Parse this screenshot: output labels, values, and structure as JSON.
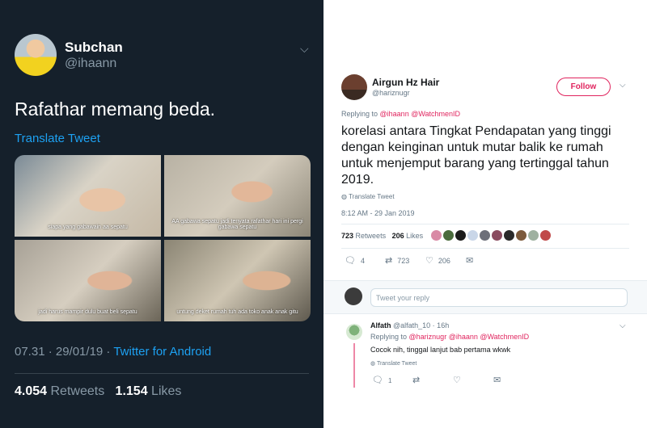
{
  "left_tweet": {
    "display_name": "Subchan",
    "handle": "@ihaann",
    "menu_icon": "chevron-down-icon",
    "text": "Rafathar memang beda.",
    "translate_label": "Translate Tweet",
    "media_captions": [
      "siapa yang gabawain aa sepatu",
      "AA gabawa sepatu jadi tenyata rafathar hari ini pergi gabawa sepatu",
      "jadi harus mampir dulu buat beli sepatu",
      "untung deket rumah tuh ada toko anak anak gitu"
    ],
    "timestamp": "07.31 · 29/01/19 · ",
    "via": "Twitter for Android",
    "retweets_count": "4.054",
    "retweets_label": "Retweets",
    "likes_count": "1.154",
    "likes_label": "Likes",
    "colors": {
      "background": "#15202b",
      "link": "#1da1f2",
      "muted": "#8899a6"
    }
  },
  "right_tweet": {
    "display_name": "Airgun Hz Hair",
    "handle": "@hariznugr",
    "follow_label": "Follow",
    "menu_icon": "chevron-down-icon",
    "replying_prefix": "Replying to ",
    "replying_mentions": "@ihaann @WatchmenID",
    "text": "korelasi antara Tingkat Pendapatan yang tinggi dengan keinginan untuk mutar balik ke rumah untuk menjemput barang yang tertinggal tahun 2019.",
    "translate_label": "Translate Tweet",
    "timestamp": "8:12 AM - 29 Jan 2019",
    "retweets_count": "723",
    "retweets_label": "Retweets",
    "likes_count": "206",
    "likes_label": "Likes",
    "liker_colors": [
      "#d98aa5",
      "#4a6b3c",
      "#1b1b1b",
      "#c9d6e8",
      "#6d6f79",
      "#8a4b5f",
      "#2a2a2a",
      "#7c5a3c",
      "#9fb1a0",
      "#c04a4a"
    ],
    "actions": {
      "reply_count": "4",
      "retweet_count": "723",
      "like_count": "206"
    },
    "colors": {
      "accent": "#e0245e",
      "muted": "#657786",
      "text": "#14171a"
    }
  },
  "reply_box": {
    "placeholder": "Tweet your reply"
  },
  "reply": {
    "display_name": "Alfath",
    "handle_time": "@alfath_10 · 16h",
    "replying_prefix": "Replying to ",
    "replying_mentions": "@hariznugr @ihaann @WatchmenID",
    "text": "Cocok nih, tinggal lanjut bab pertama wkwk",
    "translate_label": "Translate Tweet",
    "actions": {
      "reply_count": "1"
    }
  }
}
